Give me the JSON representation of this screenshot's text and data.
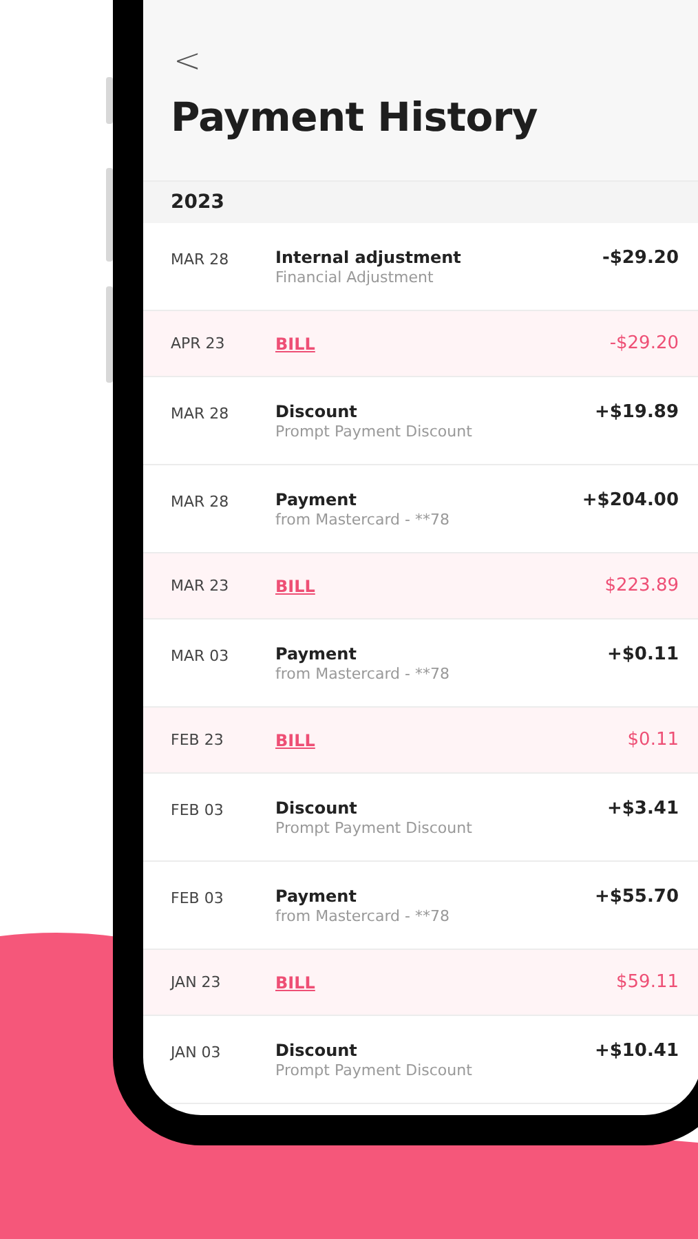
{
  "screen": {
    "title": "Payment History",
    "back": "<"
  },
  "sections": [
    {
      "year": "2023",
      "rows": [
        {
          "kind": "transaction",
          "date": "MAR 28",
          "title": "Internal adjustment",
          "detail": "Financial Adjustment",
          "amount": "-$29.20"
        },
        {
          "kind": "bill",
          "date": "APR 23",
          "title": "BILL",
          "amount": "-$29.20"
        },
        {
          "kind": "transaction",
          "date": "MAR 28",
          "title": "Discount",
          "detail": "Prompt Payment Discount",
          "amount": "+$19.89"
        },
        {
          "kind": "transaction",
          "date": "MAR 28",
          "title": "Payment",
          "detail": "from Mastercard - **78",
          "amount": "+$204.00"
        },
        {
          "kind": "bill",
          "date": "MAR 23",
          "title": "BILL",
          "amount": "$223.89"
        },
        {
          "kind": "transaction",
          "date": "MAR 03",
          "title": "Payment",
          "detail": "from Mastercard - **78",
          "amount": "+$0.11"
        },
        {
          "kind": "bill",
          "date": "FEB 23",
          "title": "BILL",
          "amount": "$0.11"
        },
        {
          "kind": "transaction",
          "date": "FEB 03",
          "title": "Discount",
          "detail": "Prompt Payment Discount",
          "amount": "+$3.41"
        },
        {
          "kind": "transaction",
          "date": "FEB 03",
          "title": "Payment",
          "detail": "from Mastercard - **78",
          "amount": "+$55.70"
        },
        {
          "kind": "bill",
          "date": "JAN 23",
          "title": "BILL",
          "amount": "$59.11"
        },
        {
          "kind": "transaction",
          "date": "JAN 03",
          "title": "Discount",
          "detail": "Prompt Payment Discount",
          "amount": "+$10.41"
        }
      ]
    }
  ]
}
